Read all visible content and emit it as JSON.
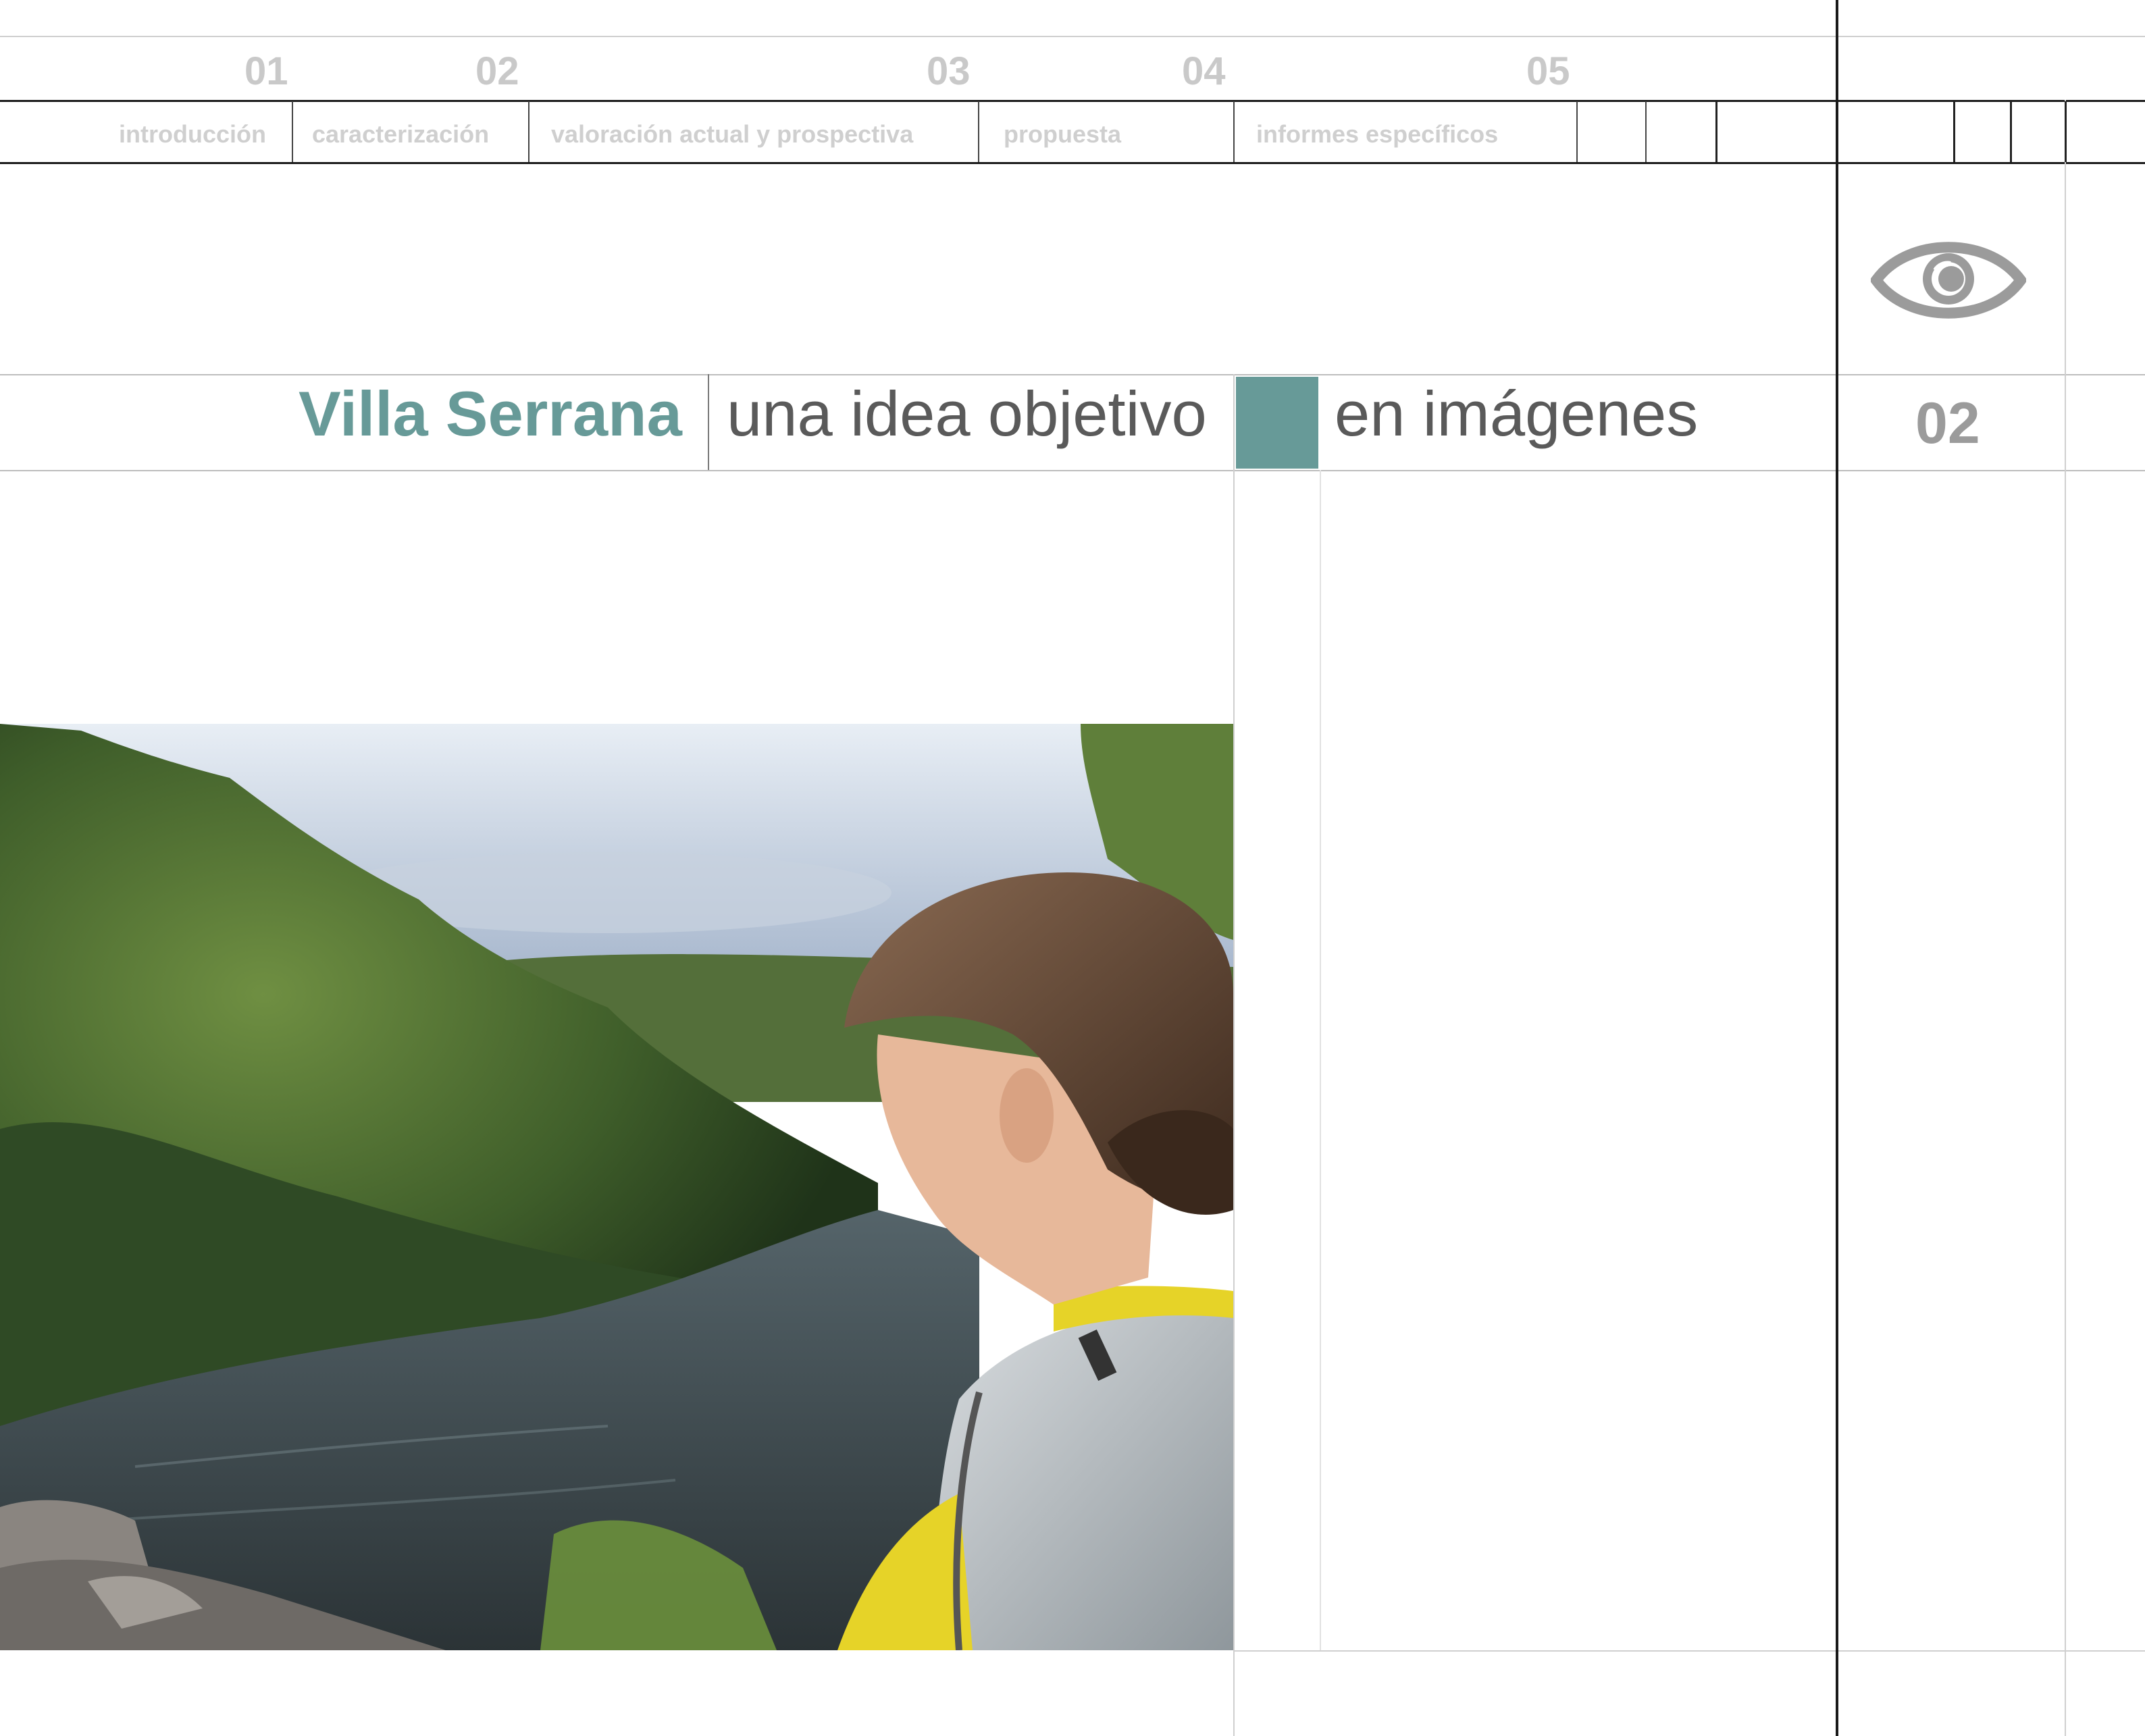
{
  "nav": {
    "numbers": [
      "01",
      "02",
      "03",
      "04",
      "05"
    ],
    "sections": [
      {
        "label": "introducción"
      },
      {
        "label": "caracterización"
      },
      {
        "label": "valoración actual y prospectiva"
      },
      {
        "label": "propuesta"
      },
      {
        "label": "informes específicos"
      }
    ]
  },
  "header": {
    "place": "Villa Serrana",
    "tagline": "una idea objetivo",
    "subtitle": "en imágenes",
    "page_number": "02"
  },
  "icons": {
    "view": "eye-icon"
  },
  "colors": {
    "accent": "#679a98",
    "title_text": "#5a5a5a",
    "nav_text": "#cfcfcf",
    "rule": "#1a1a1a"
  },
  "photo": {
    "subject": "river-landscape-with-woman-photo"
  }
}
